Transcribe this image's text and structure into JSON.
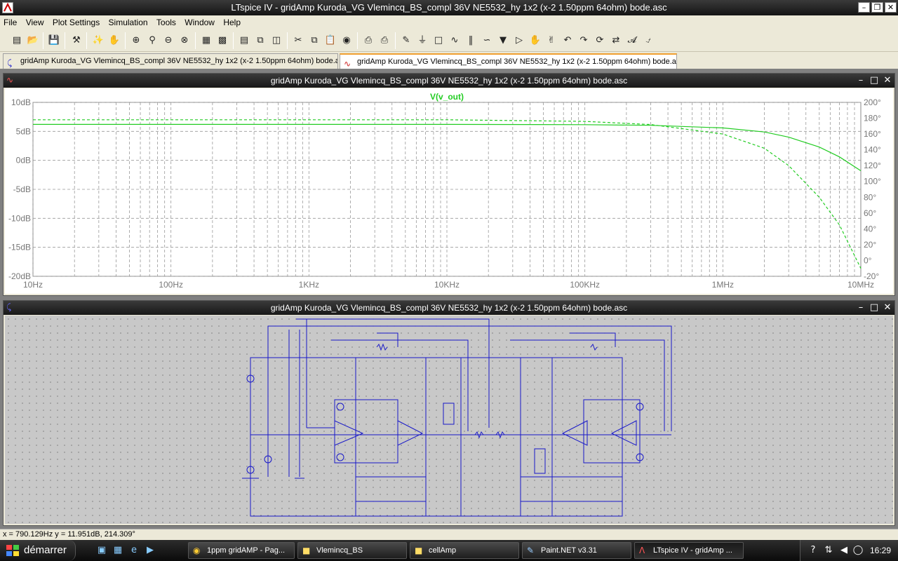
{
  "window": {
    "title": "LTspice IV - gridAmp Kuroda_VG Vlemincq_BS_compl 36V NE5532_hy 1x2 (x-2 1.50ppm 64ohm) bode.asc"
  },
  "menu": [
    "File",
    "View",
    "Plot Settings",
    "Simulation",
    "Tools",
    "Window",
    "Help"
  ],
  "doc_tabs": [
    {
      "label": "gridAmp Kuroda_VG Vlemincq_BS_compl 36V NE5532_hy 1x2 (x-2 1.50ppm 64ohm) bode.asc",
      "icon": "schematic-icon"
    },
    {
      "label": "gridAmp Kuroda_VG Vlemincq_BS_compl 36V NE5532_hy 1x2 (x-2 1.50ppm 64ohm) bode.asc",
      "icon": "waveform-icon"
    }
  ],
  "plot_window": {
    "title": "gridAmp Kuroda_VG Vlemincq_BS_compl 36V NE5532_hy 1x2 (x-2 1.50ppm 64ohm) bode.asc"
  },
  "schematic_window": {
    "title": "gridAmp Kuroda_VG Vlemincq_BS_compl 36V NE5532_hy 1x2 (x-2 1.50ppm 64ohm) bode.asc"
  },
  "status": {
    "cursor": "x = 790.129Hz    y = 11.951dB, 214.309°"
  },
  "taskbar": {
    "start_label": "démarrer",
    "tasks": [
      {
        "label": "1ppm gridAMP - Pag...",
        "icon": "chrome-icon"
      },
      {
        "label": "Vlemincq_BS",
        "icon": "folder-icon"
      },
      {
        "label": "cellAmp",
        "icon": "folder-icon"
      },
      {
        "label": "Paint.NET v3.31",
        "icon": "paint-icon"
      },
      {
        "label": "LTspice IV - gridAmp ...",
        "icon": "ltspice-icon"
      }
    ],
    "clock": "16:29"
  },
  "chart_data": {
    "type": "line",
    "title": "V(v_out)",
    "x_scale": "log",
    "xlim": [
      10,
      10000000
    ],
    "x_ticks": [
      "10Hz",
      "100Hz",
      "1KHz",
      "10KHz",
      "100KHz",
      "1MHz",
      "10MHz"
    ],
    "ylim": [
      -20,
      10
    ],
    "y_ticks": [
      "10dB",
      "5dB",
      "0dB",
      "-5dB",
      "-10dB",
      "-15dB",
      "-20dB"
    ],
    "y2lim": [
      -20,
      200
    ],
    "y2_ticks": [
      "200°",
      "180°",
      "160°",
      "140°",
      "120°",
      "100°",
      "80°",
      "60°",
      "40°",
      "20°",
      "0°",
      "-20°"
    ],
    "grid": true,
    "color": "#22cc22",
    "series": [
      {
        "name": "V(v_out)",
        "axis": "left",
        "style": "solid",
        "x": [
          10,
          100,
          1000,
          10000,
          100000,
          300000,
          1000000,
          2000000,
          3000000,
          5000000,
          7000000,
          10000000
        ],
        "values": [
          6.2,
          6.2,
          6.2,
          6.2,
          6.15,
          6.05,
          5.6,
          4.9,
          4.0,
          2.3,
          0.6,
          -1.8
        ]
      },
      {
        "name": "phase",
        "axis": "right",
        "style": "dashed",
        "x": [
          10,
          100,
          1000,
          10000,
          100000,
          300000,
          1000000,
          2000000,
          3000000,
          5000000,
          7000000,
          10000000
        ],
        "values": [
          178,
          178,
          178,
          178,
          176,
          172,
          160,
          142,
          120,
          80,
          45,
          -10
        ]
      }
    ]
  }
}
